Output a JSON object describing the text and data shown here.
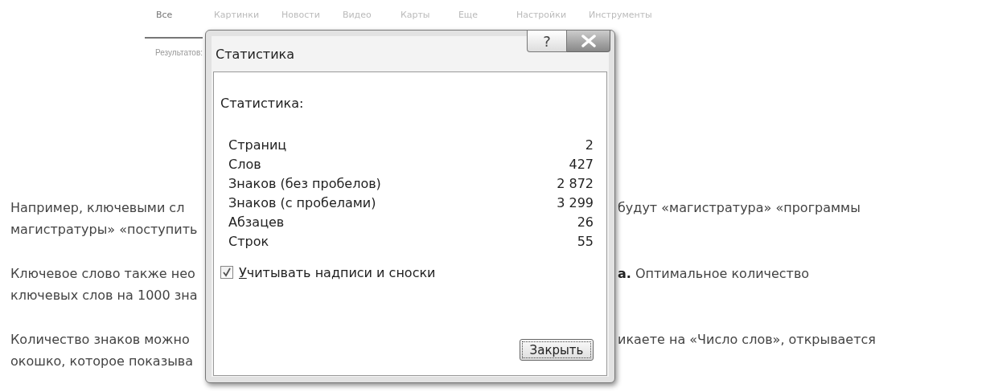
{
  "nav_tabs": [
    {
      "label": "Все",
      "selected": true
    },
    {
      "label": "Картинки",
      "selected": false
    },
    {
      "label": "Новости",
      "selected": false
    },
    {
      "label": "Видео",
      "selected": false
    },
    {
      "label": "Карты",
      "selected": false
    },
    {
      "label": "Еще",
      "selected": false
    },
    {
      "label": "Настройки",
      "selected": false
    },
    {
      "label": "Инструменты",
      "selected": false
    }
  ],
  "results_text": "Результатов:",
  "article": {
    "paragraphs": [
      [
        {
          "left": "Например, ключевыми сл",
          "right": "будут «магистратура» «программы"
        },
        {
          "left": "магистратуры» «поступить"
        }
      ],
      [
        {
          "left": "Ключевое слово также нео",
          "right": "**а.** Оптимальное количество"
        },
        {
          "left": "ключевых слов на 1000 зна"
        }
      ],
      [
        {
          "left": "Количество знаков можно",
          "right": "икаете на «Число слов», открывается"
        },
        {
          "left": "окошко, которое показыва"
        }
      ]
    ]
  },
  "dialog": {
    "title": "Статистика",
    "help_button": "?",
    "section_label": "Статистика:",
    "stats": [
      {
        "label": "Страниц",
        "value": "2"
      },
      {
        "label": "Слов",
        "value": "427"
      },
      {
        "label": "Знаков (без пробелов)",
        "value": "2 872"
      },
      {
        "label": "Знаков (с пробелами)",
        "value": "3 299"
      },
      {
        "label": "Абзацев",
        "value": "26"
      },
      {
        "label": "Строк",
        "value": "55"
      }
    ],
    "checkbox": {
      "label": "Учитывать надписи и сноски",
      "checked": true
    },
    "close_button": "Закрыть"
  }
}
